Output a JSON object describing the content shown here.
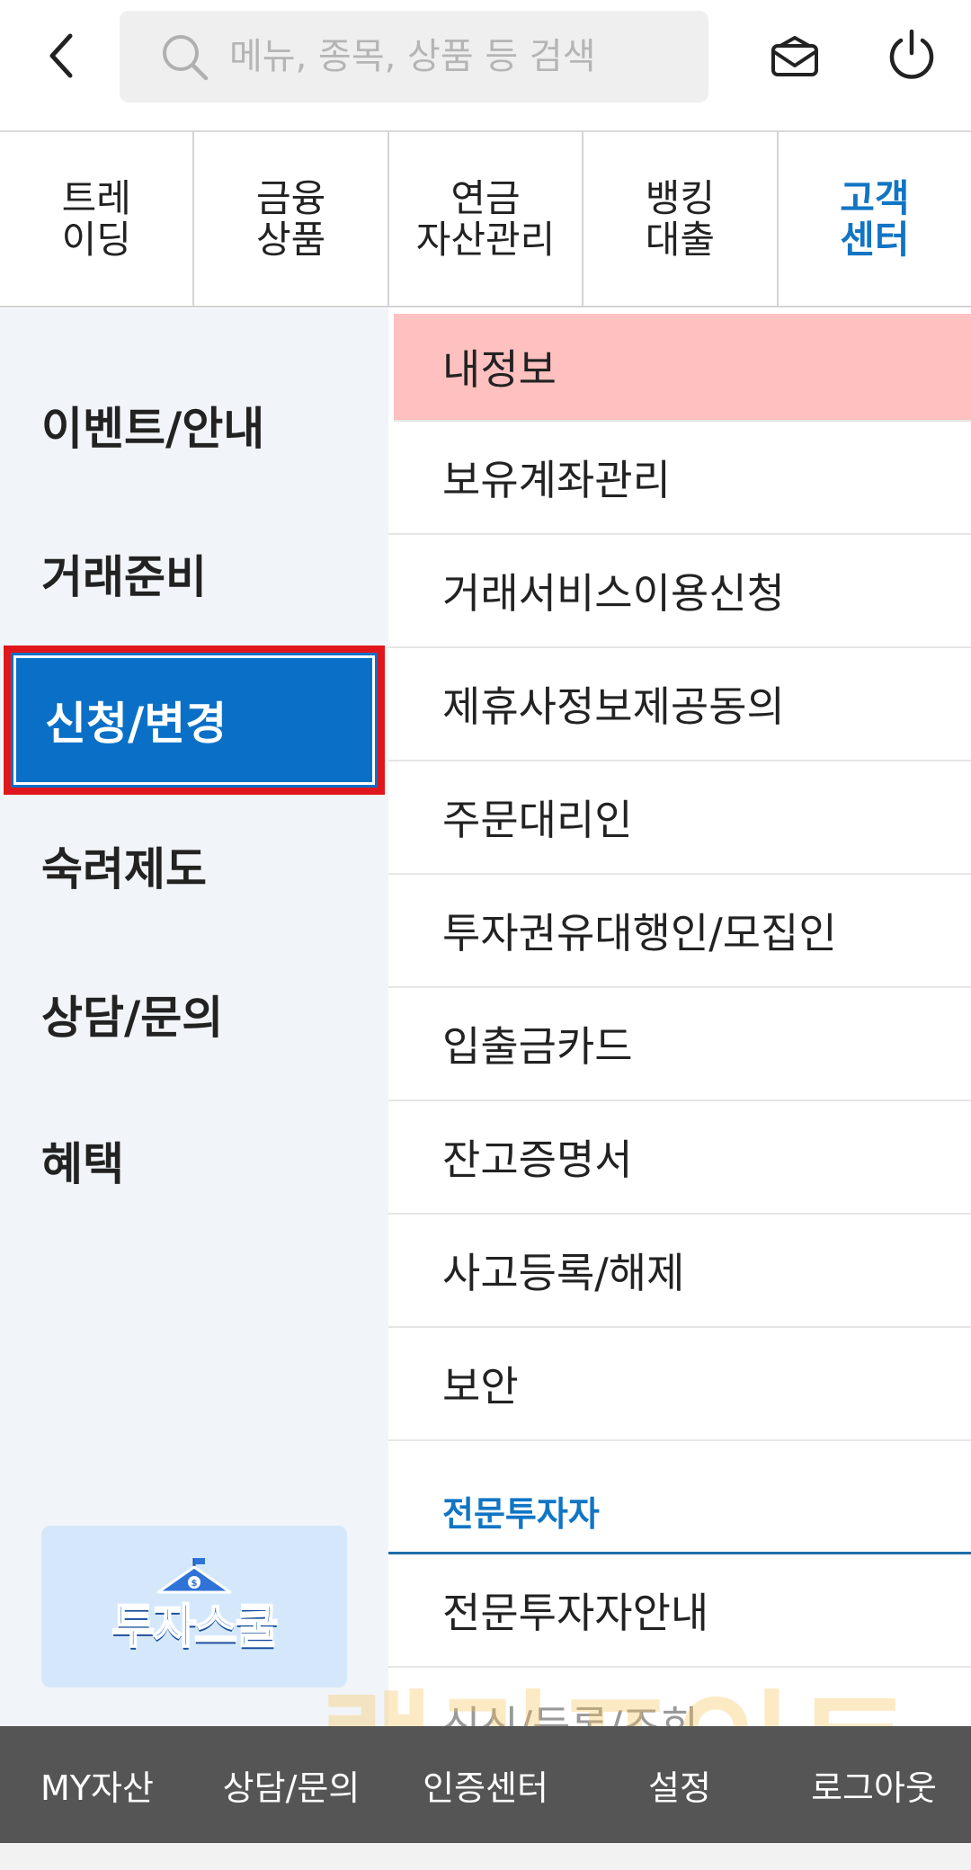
{
  "header": {
    "back_icon": "chevron-left-icon",
    "search_placeholder": "메뉴, 종목, 상품 등 검색",
    "search_icon": "search-icon",
    "mail_icon": "mail-icon",
    "power_icon": "power-icon"
  },
  "tabs": [
    {
      "label": "트레\n이딩"
    },
    {
      "label": "금융\n상품"
    },
    {
      "label": "연금\n자산관리"
    },
    {
      "label": "뱅킹\n대출"
    },
    {
      "label": "고객\n센터",
      "active": true
    }
  ],
  "left_menu": {
    "items": [
      {
        "label": "이벤트/안내"
      },
      {
        "label": "거래준비"
      },
      {
        "label": "신청/변경",
        "active": true
      },
      {
        "label": "숙려제도"
      },
      {
        "label": "상담/문의"
      },
      {
        "label": "혜택"
      }
    ],
    "promo": {
      "label": "투자스쿨",
      "icon": "school-icon"
    }
  },
  "right_list": {
    "items": [
      {
        "label": "내정보",
        "highlight": true
      },
      {
        "label": "보유계좌관리"
      },
      {
        "label": "거래서비스이용신청"
      },
      {
        "label": "제휴사정보제공동의"
      },
      {
        "label": "주문대리인"
      },
      {
        "label": "투자권유대행인/모집인"
      },
      {
        "label": "입출금카드"
      },
      {
        "label": "잔고증명서"
      },
      {
        "label": "사고등록/해제"
      },
      {
        "label": "보안"
      }
    ],
    "section_title": "전문투자자",
    "section_items": [
      {
        "label": "전문투자자안내"
      },
      {
        "label": "신신/등록/조회"
      }
    ]
  },
  "watermark": "랠리포인트",
  "bottom_bar": {
    "items": [
      {
        "label": "MY자산"
      },
      {
        "label": "상담/문의"
      },
      {
        "label": "인증센터"
      },
      {
        "label": "설정"
      },
      {
        "label": "로그아웃"
      }
    ]
  },
  "colors": {
    "accent": "#0a70c7",
    "highlight_row": "#ffc0c0",
    "selected_border": "#e0161d",
    "bottom_bar": "#555555",
    "left_menu_bg": "#f1f4f8"
  }
}
